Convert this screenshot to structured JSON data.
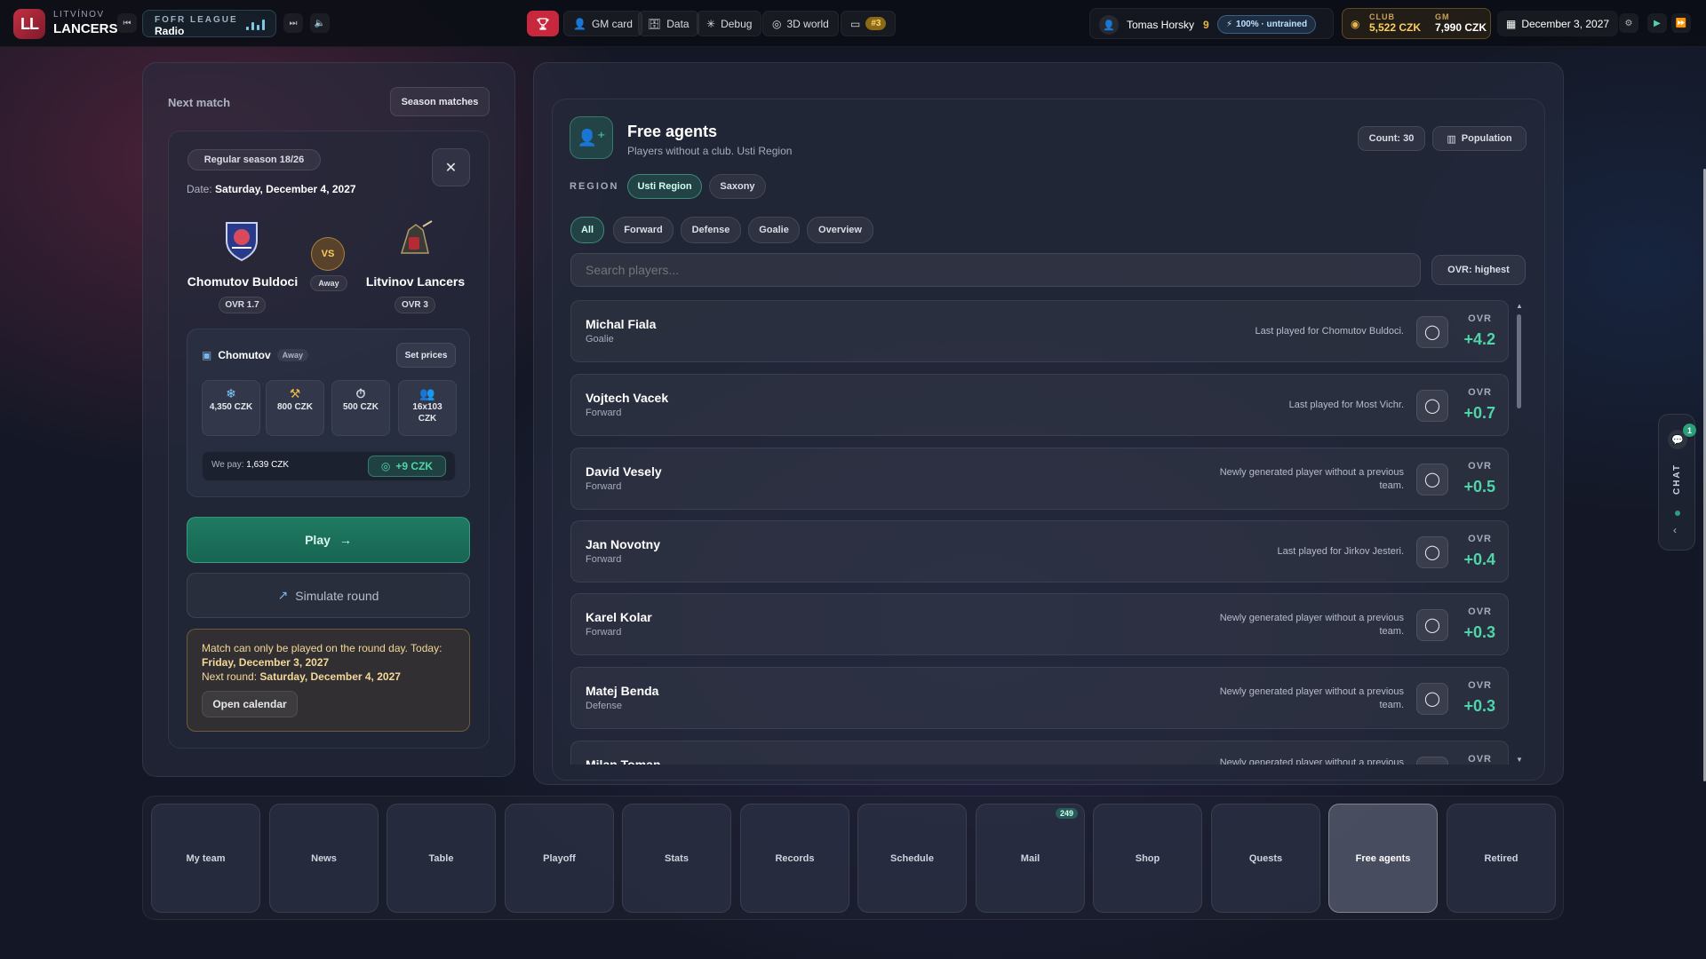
{
  "brand": {
    "line1": "LITVÍNOV",
    "line2": "LANCERS",
    "logo": "LL"
  },
  "radio": {
    "label": "FOFR LEAGUE",
    "station": "Radio"
  },
  "nav": {
    "gm_card": "GM card",
    "data": "Data",
    "debug": "Debug",
    "world": "3D world",
    "rank_badge": "#3"
  },
  "user": {
    "name": "Tomas Horsky",
    "level": "9",
    "training": "100% · untrained"
  },
  "money": {
    "club_label": "CLUB",
    "club_value": "5,522 CZK",
    "gm_label": "GM",
    "gm_value": "7,990 CZK"
  },
  "date": "December 3, 2027",
  "next_match": {
    "title": "Next match",
    "season_button": "Season matches",
    "season_tag": "Regular season 18/26",
    "date_label": "Date:",
    "date_value": "Saturday, December 4, 2027",
    "home": {
      "name": "Chomutov Buldoci",
      "ovr": "OVR 1.7"
    },
    "vs": "VS",
    "venue_tag": "Away",
    "away": {
      "name": "Litvinov Lancers",
      "ovr": "OVR 3"
    },
    "arena": {
      "name": "Chomutov",
      "tag": "Away",
      "set_prices": "Set prices"
    },
    "stats": [
      {
        "icon": "snowflake-icon",
        "value": "4,350 CZK"
      },
      {
        "icon": "hammer-icon",
        "value": "800 CZK"
      },
      {
        "icon": "stopwatch-icon",
        "value": "500 CZK"
      },
      {
        "icon": "people-icon",
        "value": "16x103 CZK"
      }
    ],
    "we_pay_label": "We pay:",
    "we_pay_value": "1,639 CZK",
    "gain": "+9 CZK",
    "play": "Play",
    "simulate": "Simulate round",
    "warning": {
      "line1": "Match can only be played on the round day. Today:",
      "line2": "Friday, December 3, 2027",
      "line3_label": "Next round:",
      "line3_value": "Saturday, December 4, 2027",
      "button": "Open calendar"
    }
  },
  "free_agents": {
    "title": "Free agents",
    "subtitle": "Players without a club. Usti Region",
    "count": "Count: 30",
    "population": "Population",
    "region_label": "REGION",
    "regions": [
      "Usti Region",
      "Saxony"
    ],
    "filters": [
      "All",
      "Forward",
      "Defense",
      "Goalie",
      "Overview"
    ],
    "search_placeholder": "Search players...",
    "sort": "OVR: highest",
    "ovr_label": "OVR",
    "players": [
      {
        "name": "Michal Fiala",
        "pos": "Goalie",
        "note": "Last played for Chomutov Buldoci.",
        "ovr": "+4.2"
      },
      {
        "name": "Vojtech Vacek",
        "pos": "Forward",
        "note": "Last played for Most Vichr.",
        "ovr": "+0.7"
      },
      {
        "name": "David Vesely",
        "pos": "Forward",
        "note": "Newly generated player without a previous team.",
        "ovr": "+0.5"
      },
      {
        "name": "Jan Novotny",
        "pos": "Forward",
        "note": "Last played for Jirkov Jesteri.",
        "ovr": "+0.4"
      },
      {
        "name": "Karel Kolar",
        "pos": "Forward",
        "note": "Newly generated player without a previous team.",
        "ovr": "+0.3"
      },
      {
        "name": "Matej Benda",
        "pos": "Defense",
        "note": "Newly generated player without a previous team.",
        "ovr": "+0.3"
      },
      {
        "name": "Milan Toman",
        "pos": "",
        "note": "Newly generated player without a previous",
        "ovr": ""
      }
    ]
  },
  "chat": {
    "label": "CHAT",
    "badge": "1"
  },
  "bottom_nav": [
    {
      "label": "My team"
    },
    {
      "label": "News"
    },
    {
      "label": "Table"
    },
    {
      "label": "Playoff"
    },
    {
      "label": "Stats"
    },
    {
      "label": "Records"
    },
    {
      "label": "Schedule"
    },
    {
      "label": "Mail",
      "badge": "249"
    },
    {
      "label": "Shop"
    },
    {
      "label": "Quests"
    },
    {
      "label": "Free agents"
    },
    {
      "label": "Retired"
    }
  ],
  "colors": {
    "accent": "#4fd6a8",
    "brand": "#c7283d",
    "gold": "#ffcf5a"
  }
}
